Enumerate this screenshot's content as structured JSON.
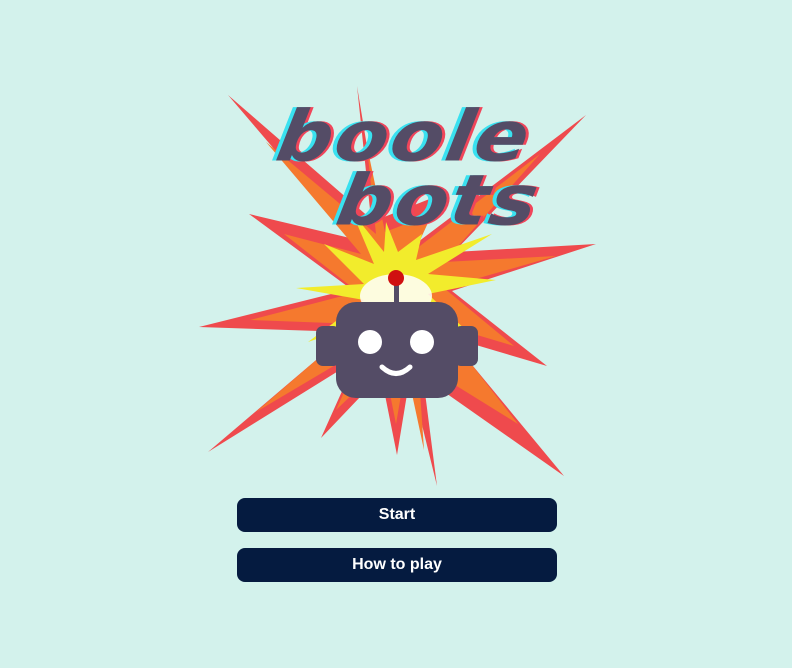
{
  "game": {
    "title_line1": "boole",
    "title_line2": "bots"
  },
  "menu": {
    "start_label": "Start",
    "how_to_play_label": "How to play"
  },
  "colors": {
    "background": "#d3f2ec",
    "button": "#051b40",
    "button_text": "#ffffff",
    "robot": "#544c66",
    "antenna_tip": "#d01010",
    "burst_outer": "#ef4a4d",
    "burst_middle": "#f5792e",
    "burst_inner": "#f2ec2c",
    "title_shadow_left": "#39e1f0",
    "title_shadow_right": "#f0455a"
  }
}
